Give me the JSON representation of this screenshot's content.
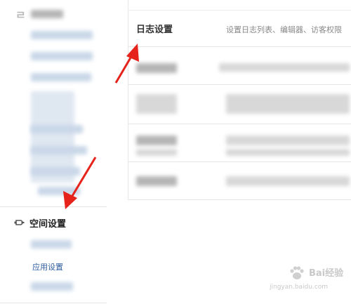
{
  "sidebar": {
    "section_title": "空间设置",
    "sub_link": "应用设置"
  },
  "main": {
    "header_title": "日志设置",
    "header_description": "设置日志列表、编辑器、访客权限"
  },
  "watermark": {
    "brand_text": "Bai\u0001 经验",
    "url": "jingyan.baidu.com"
  },
  "colors": {
    "arrow": "#e5231b",
    "link": "#2e5d9b",
    "blur_blue": "#c9d7e8"
  },
  "icons": {
    "section_icon": "puzzle-plug-icon",
    "watermark_icon": "paw-icon"
  }
}
